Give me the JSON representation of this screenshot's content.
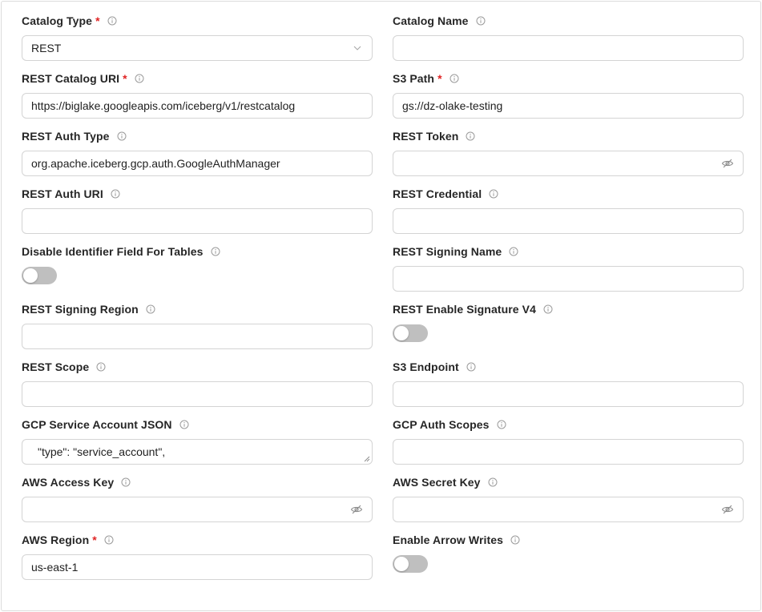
{
  "fields": {
    "catalog_type": {
      "label": "Catalog Type",
      "required": "*",
      "value": "REST"
    },
    "catalog_name": {
      "label": "Catalog Name",
      "value": ""
    },
    "rest_catalog_uri": {
      "label": "REST Catalog URI",
      "required": "*",
      "value": "https://biglake.googleapis.com/iceberg/v1/restcatalog"
    },
    "s3_path": {
      "label": "S3 Path",
      "required": "*",
      "value": "gs://dz-olake-testing"
    },
    "rest_auth_type": {
      "label": "REST Auth Type",
      "value": "org.apache.iceberg.gcp.auth.GoogleAuthManager"
    },
    "rest_token": {
      "label": "REST Token",
      "value": ""
    },
    "rest_auth_uri": {
      "label": "REST Auth URI",
      "value": ""
    },
    "rest_credential": {
      "label": "REST Credential",
      "value": ""
    },
    "disable_identifier": {
      "label": "Disable Identifier Field For Tables",
      "enabled": false
    },
    "rest_signing_name": {
      "label": "REST Signing Name",
      "value": ""
    },
    "rest_signing_region": {
      "label": "REST Signing Region",
      "value": ""
    },
    "rest_enable_sig_v4": {
      "label": "REST Enable Signature V4",
      "enabled": false
    },
    "rest_scope": {
      "label": "REST Scope",
      "value": ""
    },
    "s3_endpoint": {
      "label": "S3 Endpoint",
      "value": ""
    },
    "gcp_service_account_json": {
      "label": "GCP Service Account JSON",
      "value": "\"type\": \"service_account\","
    },
    "gcp_auth_scopes": {
      "label": "GCP Auth Scopes",
      "value": ""
    },
    "aws_access_key": {
      "label": "AWS Access Key",
      "value": ""
    },
    "aws_secret_key": {
      "label": "AWS Secret Key",
      "value": ""
    },
    "aws_region": {
      "label": "AWS Region",
      "required": "*",
      "value": "us-east-1"
    },
    "enable_arrow_writes": {
      "label": "Enable Arrow Writes",
      "enabled": false
    }
  },
  "icons": {
    "info": "info-circle-icon",
    "select": "chevron-down-icon",
    "password": "eye-slash-icon"
  },
  "colors": {
    "required": "#e02424",
    "toggle_off": "#bfbfbf",
    "border": "#d4d4d4"
  }
}
